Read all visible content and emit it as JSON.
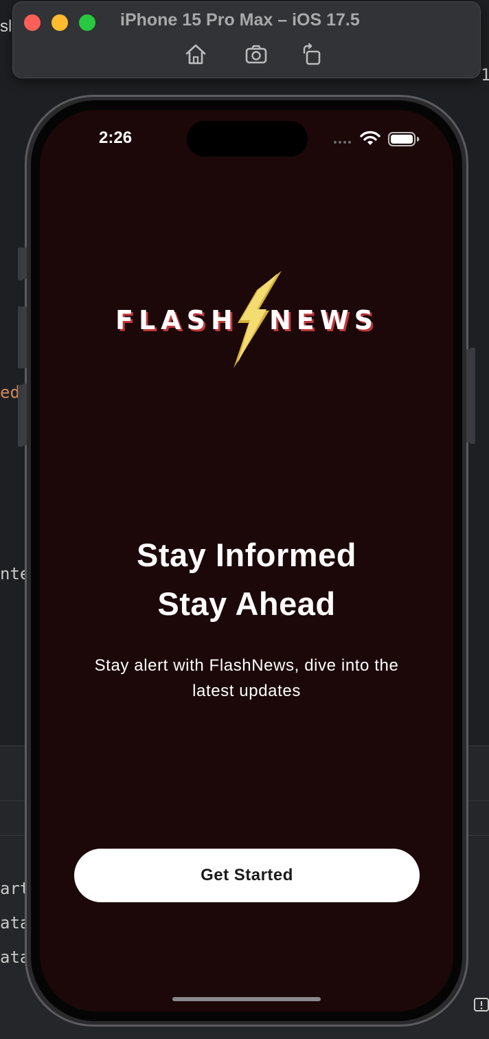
{
  "simulator": {
    "title": "iPhone 15 Pro Max – iOS 17.5",
    "toolbar": [
      {
        "icon": "home-icon"
      },
      {
        "icon": "screenshot-icon"
      },
      {
        "icon": "rotate-icon"
      }
    ]
  },
  "background_editor": {
    "fragments": [
      "sl",
      "ed",
      "nte",
      "art:",
      "ata",
      "ata",
      "1"
    ]
  },
  "status_bar": {
    "time": "2:26",
    "icons": [
      "cellular-icon",
      "wifi-icon",
      "battery-icon"
    ]
  },
  "app": {
    "logo": {
      "left": "FLASH",
      "right": "NEWS",
      "bolt_color": "#f2d04e",
      "accent_color": "#c0383c"
    },
    "headline_line1": "Stay Informed",
    "headline_line2": "Stay Ahead",
    "subtext": "Stay alert with FlashNews, dive into the latest updates",
    "cta_label": "Get Started"
  },
  "colors": {
    "screen_background": "#1c0809",
    "button_background": "#ffffff",
    "text": "#ffffff"
  }
}
